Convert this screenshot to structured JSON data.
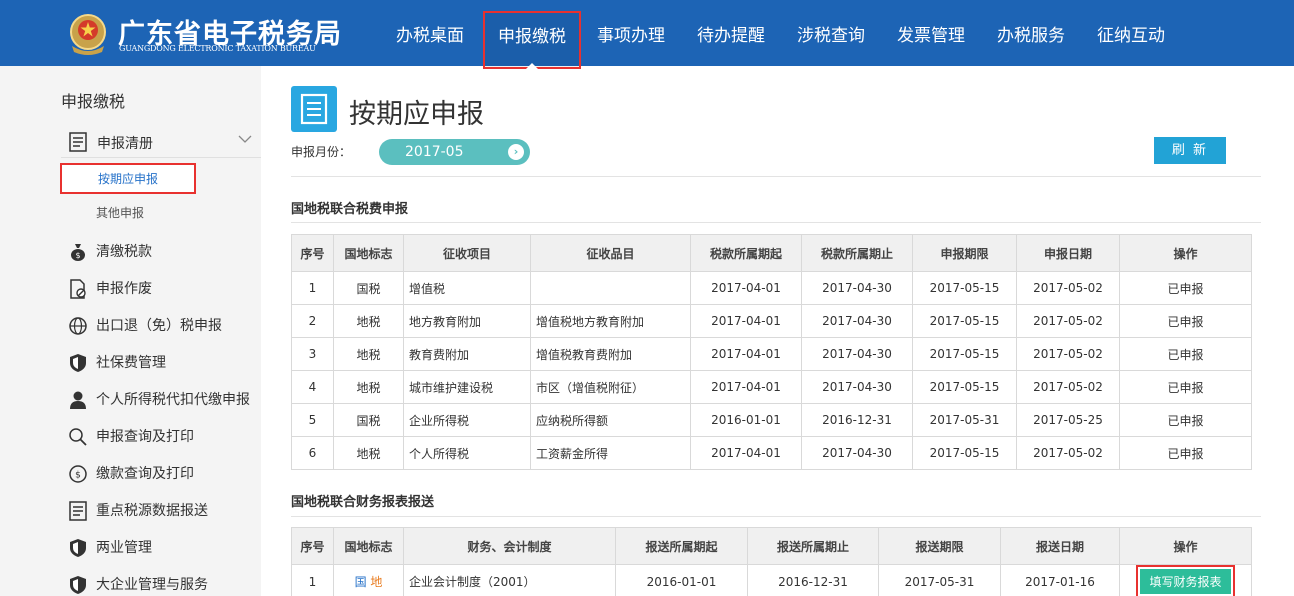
{
  "header": {
    "logo_title": "广东省电子税务局",
    "logo_subtitle": "GUANGDONG ELECTRONIC TAXATION BUREAU",
    "nav": [
      {
        "label": "办税桌面"
      },
      {
        "label": "申报缴税"
      },
      {
        "label": "事项办理"
      },
      {
        "label": "待办提醒"
      },
      {
        "label": "涉税查询"
      },
      {
        "label": "发票管理"
      },
      {
        "label": "办税服务"
      },
      {
        "label": "征纳互动"
      }
    ],
    "active_nav": "申报缴税"
  },
  "sidebar": {
    "title": "申报缴税",
    "group": {
      "label": "申报清册",
      "icon": "list-icon"
    },
    "sub_items": [
      {
        "label": "按期应申报",
        "active": true
      },
      {
        "label": "其他申报",
        "active": false
      }
    ],
    "items": [
      {
        "label": "清缴税款",
        "icon": "money-bag-icon"
      },
      {
        "label": "申报作废",
        "icon": "document-cancel-icon"
      },
      {
        "label": "出口退（免）税申报",
        "icon": "globe-icon"
      },
      {
        "label": "社保费管理",
        "icon": "shield-icon"
      },
      {
        "label": "个人所得税代扣代缴申报",
        "icon": "person-icon"
      },
      {
        "label": "申报查询及打印",
        "icon": "search-icon"
      },
      {
        "label": "缴款查询及打印",
        "icon": "coin-icon"
      },
      {
        "label": "重点税源数据报送",
        "icon": "list-icon"
      },
      {
        "label": "两业管理",
        "icon": "shield-icon"
      },
      {
        "label": "大企业管理与服务",
        "icon": "shield-icon"
      }
    ]
  },
  "main": {
    "page_title": "按期应申报",
    "month_label": "申报月份：",
    "month_value": "2017-05",
    "refresh_label": "刷 新",
    "tax_section": {
      "title": "国地税联合税费申报",
      "headers": [
        "序号",
        "国地标志",
        "征收项目",
        "征收品目",
        "税款所属期起",
        "税款所属期止",
        "申报期限",
        "申报日期",
        "操作"
      ],
      "rows": [
        {
          "no": "1",
          "flag": "国税",
          "flag_type": "guo",
          "item": "增值税",
          "subitem": "",
          "start": "2017-04-01",
          "end": "2017-04-30",
          "deadline": "2017-05-15",
          "date": "2017-05-02",
          "op": "已申报"
        },
        {
          "no": "2",
          "flag": "地税",
          "flag_type": "di",
          "item": "地方教育附加",
          "subitem": "增值税地方教育附加",
          "start": "2017-04-01",
          "end": "2017-04-30",
          "deadline": "2017-05-15",
          "date": "2017-05-02",
          "op": "已申报"
        },
        {
          "no": "3",
          "flag": "地税",
          "flag_type": "di",
          "item": "教育费附加",
          "subitem": "增值税教育费附加",
          "start": "2017-04-01",
          "end": "2017-04-30",
          "deadline": "2017-05-15",
          "date": "2017-05-02",
          "op": "已申报"
        },
        {
          "no": "4",
          "flag": "地税",
          "flag_type": "di",
          "item": "城市维护建设税",
          "subitem": "市区（增值税附征）",
          "start": "2017-04-01",
          "end": "2017-04-30",
          "deadline": "2017-05-15",
          "date": "2017-05-02",
          "op": "已申报"
        },
        {
          "no": "5",
          "flag": "国税",
          "flag_type": "guo",
          "item": "企业所得税",
          "subitem": "应纳税所得额",
          "start": "2016-01-01",
          "end": "2016-12-31",
          "deadline": "2017-05-31",
          "date": "2017-05-25",
          "op": "已申报"
        },
        {
          "no": "6",
          "flag": "地税",
          "flag_type": "di",
          "item": "个人所得税",
          "subitem": "工资薪金所得",
          "start": "2017-04-01",
          "end": "2017-04-30",
          "deadline": "2017-05-15",
          "date": "2017-05-02",
          "op": "已申报"
        }
      ]
    },
    "report_section": {
      "title": "国地税联合财务报表报送",
      "headers": [
        "序号",
        "国地标志",
        "财务、会计制度",
        "报送所属期起",
        "报送所属期止",
        "报送期限",
        "报送日期",
        "操作"
      ],
      "rows": [
        {
          "no": "1",
          "flag_guo": "国",
          "flag_di": "地",
          "system": "企业会计制度（2001）",
          "start": "2016-01-01",
          "end": "2016-12-31",
          "deadline": "2017-05-31",
          "date": "2017-01-16",
          "op": "填写财务报表"
        }
      ]
    }
  },
  "colors": {
    "header_bg": "#1d64b5",
    "highlight_border": "#e8312f",
    "guo": "#2672c9",
    "di": "#e87a1d",
    "pill": "#5bbfbf",
    "button": "#22a3d6",
    "action_button": "#2dbd9a"
  }
}
